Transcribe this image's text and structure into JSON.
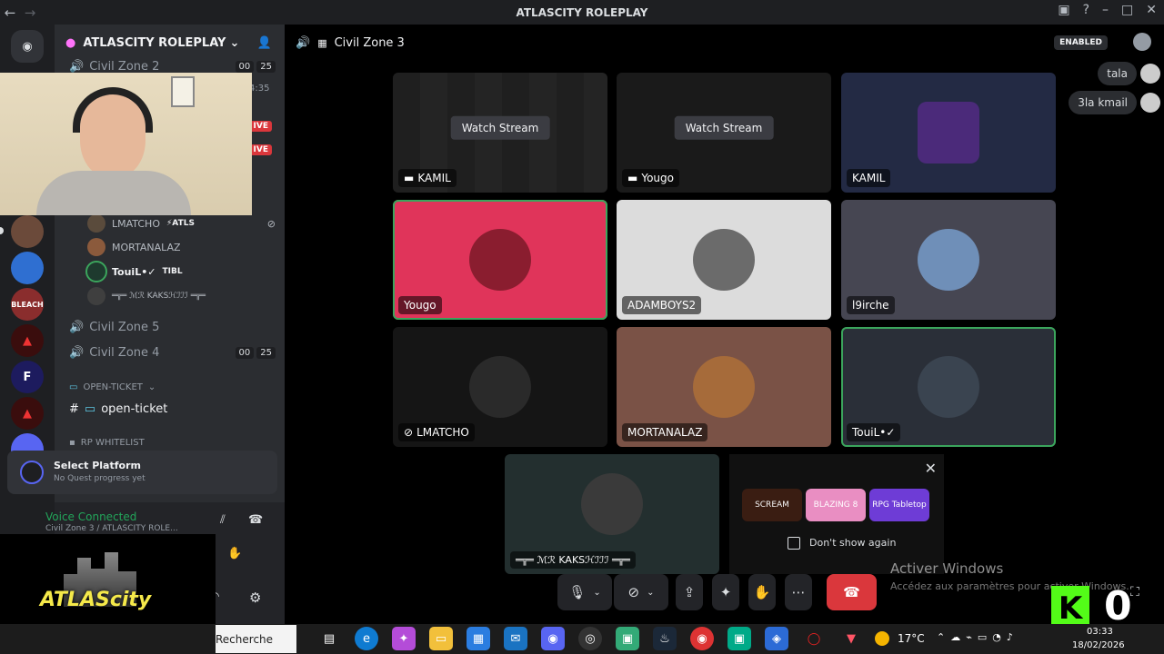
{
  "window": {
    "title": "ATLASCITY ROLEPLAY"
  },
  "server": {
    "name": "ATLASCITY ROLEPLAY"
  },
  "channels": [
    {
      "name": "Civil Zone 2",
      "counts": [
        "00",
        "25"
      ]
    },
    {
      "name": "Civil Zone 5"
    },
    {
      "name": "Civil Zone 4",
      "counts": [
        "00",
        "25"
      ]
    }
  ],
  "voice_users": [
    {
      "name": "LMATCHO",
      "tag": "⚡ATLS"
    },
    {
      "name": "MORTANALAZ"
    },
    {
      "name": "TouiL•✓",
      "tag": "TIBL"
    },
    {
      "name": "═╦═ ℳℛ KAKSℋℐℐℐ ═╦═"
    }
  ],
  "sidebar_misc": {
    "time_partial": "4:35",
    "live_label": "LIVE",
    "live_partial": "IVE"
  },
  "categories": {
    "ticket": "OPEN-TICKET",
    "ticket_channel": "open-ticket",
    "whitelist": "RP WHITELIST"
  },
  "quest": {
    "title": "Select Platform",
    "subtitle": "No Quest progress yet"
  },
  "voice_panel": {
    "status": "Voice Connected",
    "channel": "Civil Zone 3 / ATLASCITY ROLE..."
  },
  "call": {
    "channel": "Civil Zone 3",
    "badge": "ENABLED"
  },
  "tiles": [
    {
      "name": "KAMIL",
      "action": "Watch Stream",
      "stream": true
    },
    {
      "name": "Yougo",
      "action": "Watch Stream",
      "stream": true
    },
    {
      "name": "KAMIL"
    },
    {
      "name": "Yougo"
    },
    {
      "name": "ADAMBOYS2"
    },
    {
      "name": "l9irche"
    },
    {
      "name": "LMATCHO",
      "muted": true
    },
    {
      "name": "MORTANALAZ"
    },
    {
      "name": "TouiL•✓"
    }
  ],
  "featured": {
    "name": "═╦═ ℳℛ KAKSℋℐℐℐ ═╦═"
  },
  "activities": {
    "dont_show": "Don't show again",
    "items": [
      "SCREAM",
      "BLAZING 8",
      "RPG Tabletop"
    ]
  },
  "chat": [
    "tala",
    "3la kmail"
  ],
  "watermark": {
    "title": "Activer Windows",
    "subtitle": "Accédez aux paramètres pour activer Windows."
  },
  "overlay": {
    "counter": "0",
    "logo_text": "ATLAScity"
  },
  "taskbar": {
    "search": "Recherche",
    "weather": "17°C",
    "time": "03:33",
    "date": "18/02/2026"
  },
  "colors": {
    "accent_green": "#3ba55c",
    "danger": "#da373c",
    "pink_tile": "#e0345a"
  }
}
